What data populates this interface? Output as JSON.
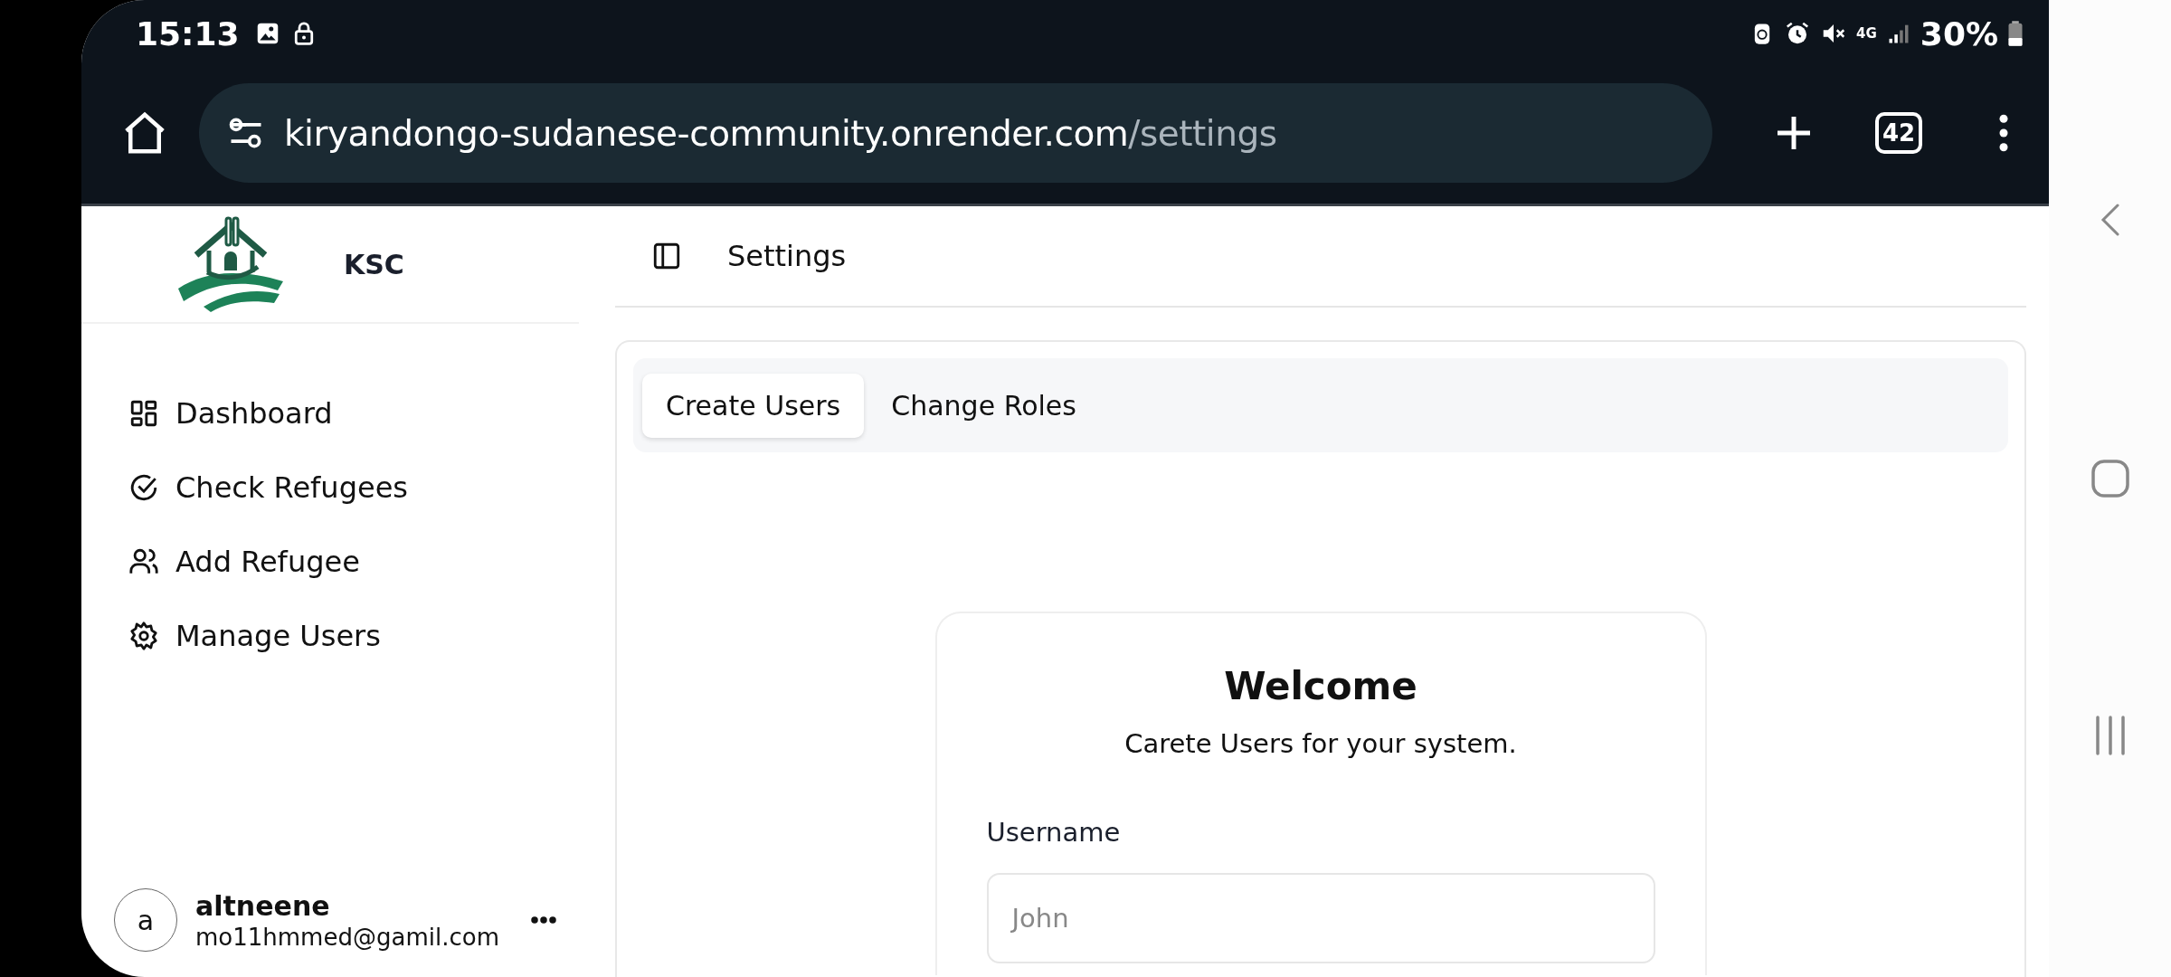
{
  "status_bar": {
    "time": "15:13",
    "network": "4G",
    "battery": "30%"
  },
  "browser": {
    "url_host": "kiryandongo-sudanese-community.onrender.com",
    "url_path": "/settings",
    "tab_count": "42"
  },
  "sidebar": {
    "brand": "KSC",
    "items": [
      {
        "label": "Dashboard",
        "kind": "grid"
      },
      {
        "label": "Check Refugees",
        "kind": "check"
      },
      {
        "label": "Add Refugee",
        "kind": "users"
      },
      {
        "label": "Manage Users",
        "kind": "gear"
      }
    ],
    "user": {
      "initial": "a",
      "name": "altneene",
      "email": "mo11hmmed@gamil.com"
    }
  },
  "header": {
    "title": "Settings"
  },
  "tabs": [
    {
      "label": "Create Users",
      "selected": true
    },
    {
      "label": "Change Roles",
      "selected": false
    }
  ],
  "form": {
    "title": "Welcome",
    "subtitle": "Carete Users for your system.",
    "fields": [
      {
        "label": "Username",
        "placeholder": "John"
      }
    ]
  }
}
